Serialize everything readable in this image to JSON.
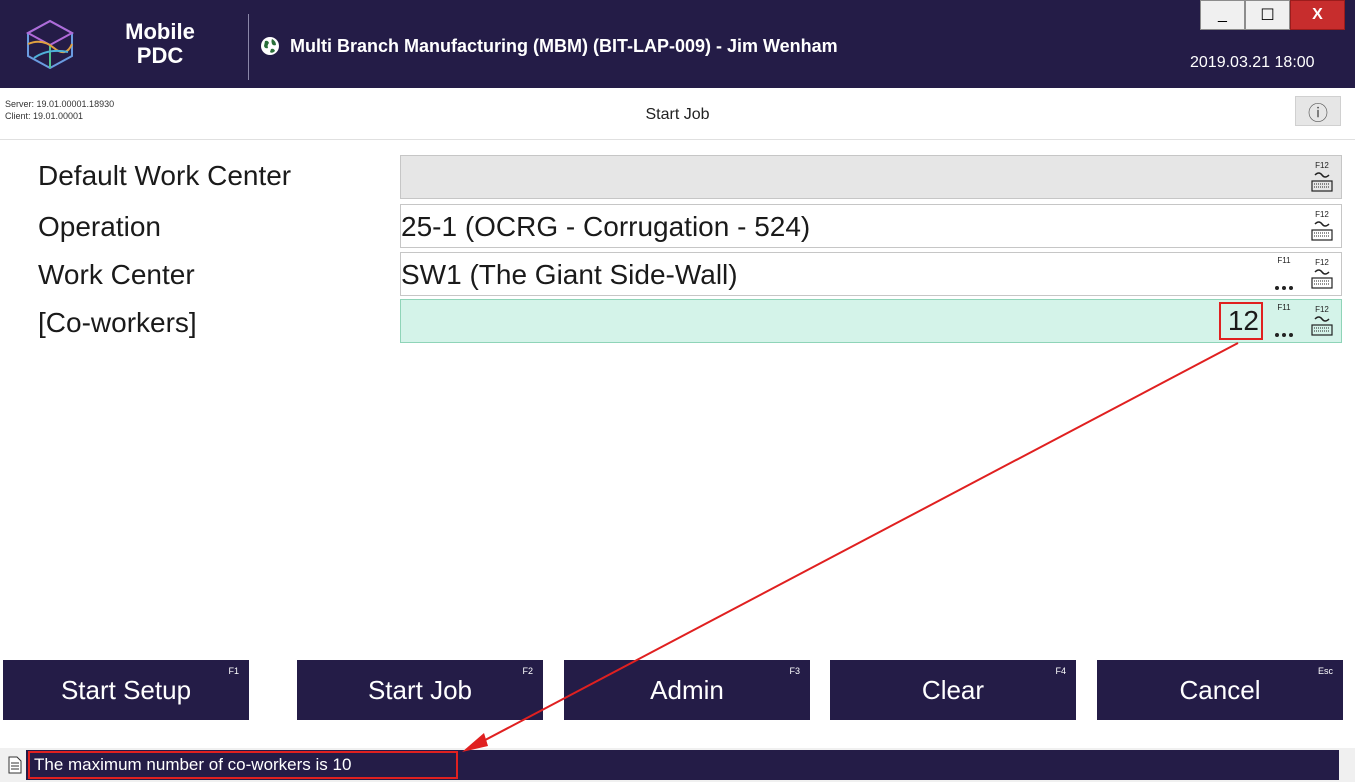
{
  "titlebar": {
    "logo_line1": "Mobile",
    "logo_line2": "PDC",
    "app_title": "Multi Branch Manufacturing (MBM) (BIT-LAP-009) - Jim Wenham",
    "datetime": "2019.03.21 18:00",
    "minimize": "_",
    "maximize": "☐",
    "close": "X"
  },
  "subheader": {
    "server_version": "Server: 19.01.00001.18930",
    "client_version": "Client: 19.01.00001",
    "screen_title": "Start Job",
    "info_icon": "ⓘ"
  },
  "form": {
    "rows": [
      {
        "label": "Default Work Center",
        "value": "",
        "state": "disabled"
      },
      {
        "label": "Operation",
        "value": "25-1 (OCRG - Corrugation - 524)",
        "state": "normal"
      },
      {
        "label": "Work Center",
        "value": "SW1 (The Giant Side-Wall)",
        "state": "normal"
      },
      {
        "label": "[Co-workers]",
        "value": "",
        "state": "active",
        "count": "12"
      }
    ],
    "fkey_keyboard": "F12",
    "fkey_lookup": "F11"
  },
  "buttons": [
    {
      "label": "Start Setup",
      "fkey": "F1"
    },
    {
      "label": "Start Job",
      "fkey": "F2"
    },
    {
      "label": "Admin",
      "fkey": "F3"
    },
    {
      "label": "Clear",
      "fkey": "F4"
    },
    {
      "label": "Cancel",
      "fkey": "Esc"
    }
  ],
  "status": {
    "message": "The maximum number of co-workers is 10"
  },
  "colors": {
    "primary": "#241c47",
    "active_field": "#d4f3e9",
    "annotation": "#e02020"
  }
}
